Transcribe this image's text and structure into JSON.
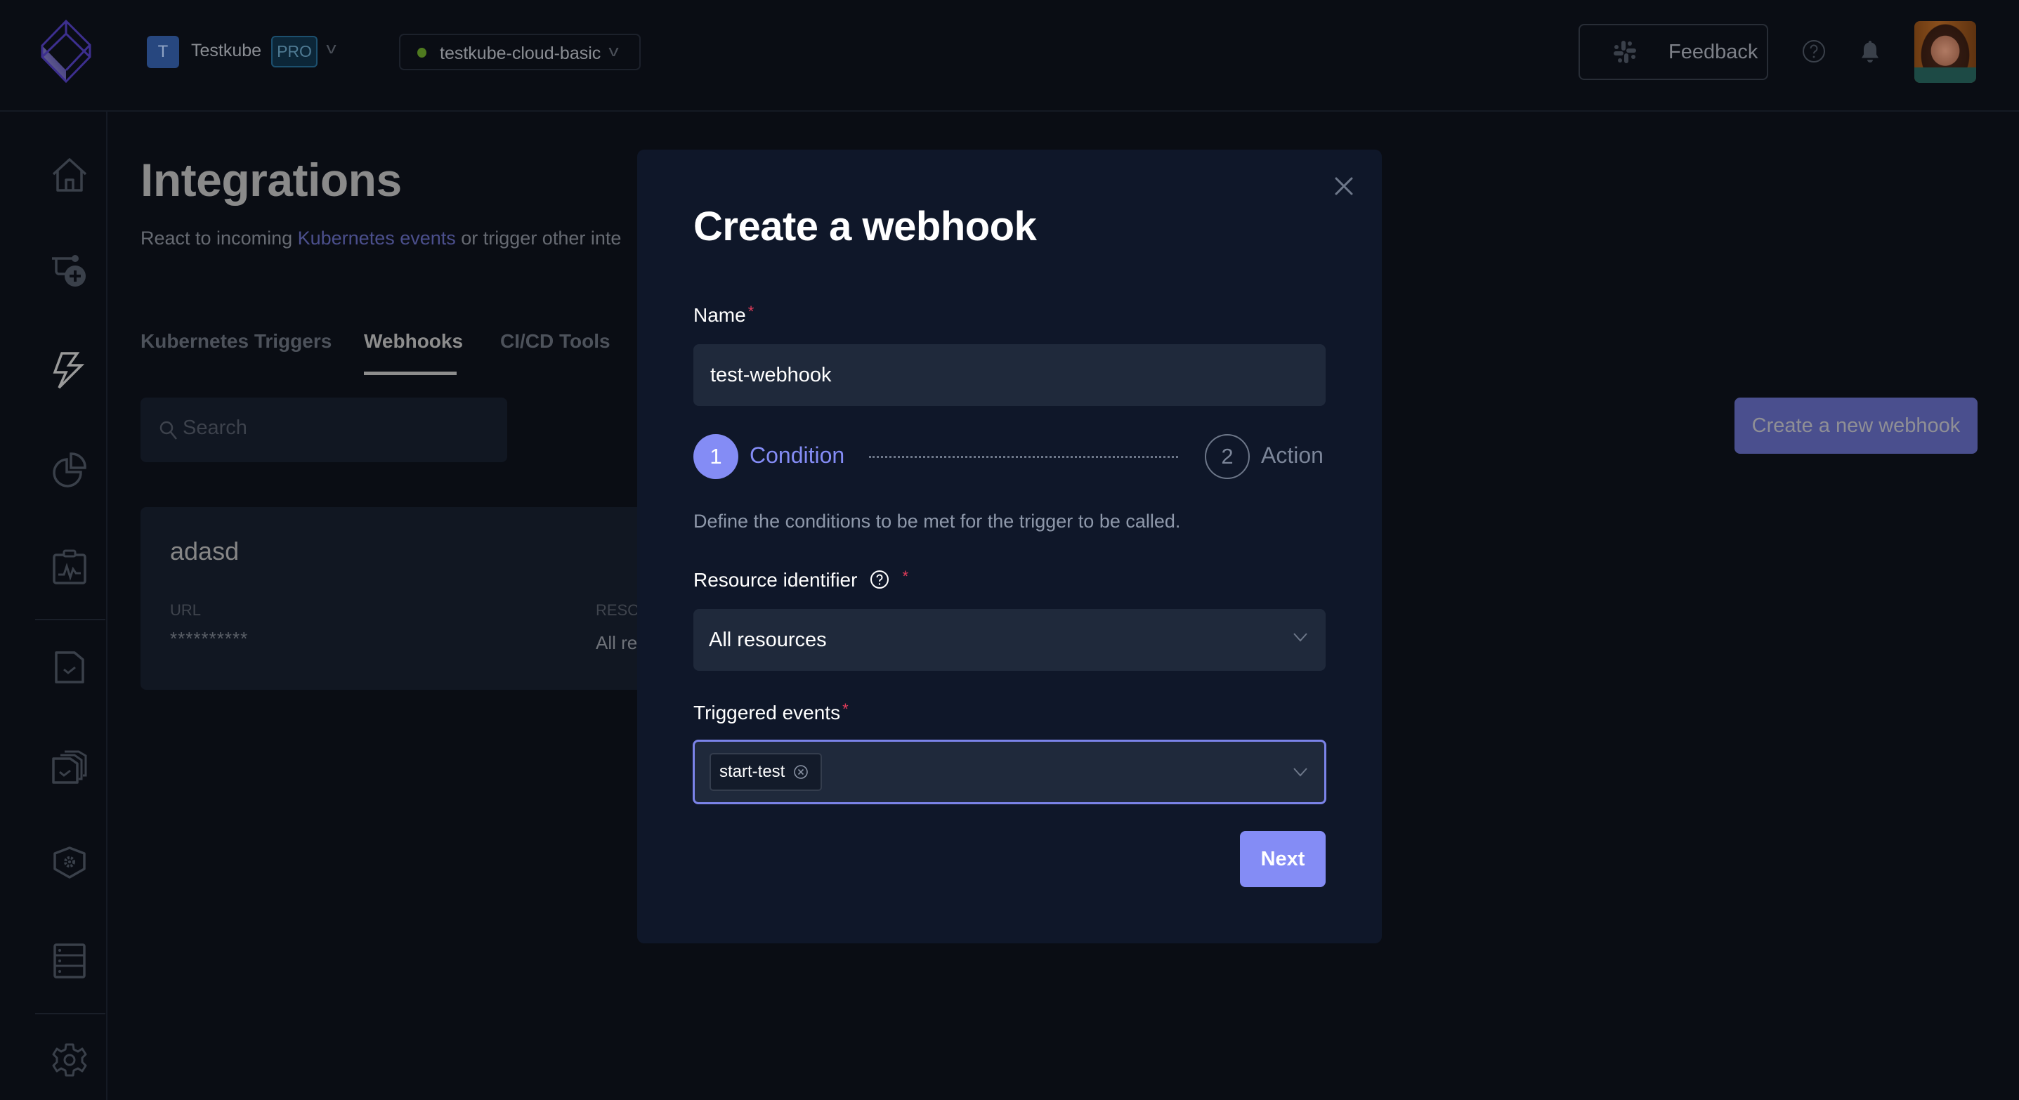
{
  "header": {
    "org": {
      "initial": "T",
      "name": "Testkube",
      "plan_badge": "PRO"
    },
    "environment": {
      "name": "testkube-cloud-basic",
      "status_color": "#4f7a1f"
    },
    "feedback_label": "Feedback"
  },
  "sidebar": {
    "items": [
      {
        "name": "home",
        "icon": "home-icon",
        "active": false
      },
      {
        "name": "triggers",
        "icon": "trigger-add-icon",
        "active": false
      },
      {
        "name": "integrations",
        "icon": "lightning-icon",
        "active": true
      },
      {
        "name": "analytics",
        "icon": "pie-chart-icon",
        "active": false
      },
      {
        "name": "status",
        "icon": "status-monitor-icon",
        "active": false
      },
      {
        "name": "tests",
        "icon": "test-file-icon",
        "active": false
      },
      {
        "name": "test-suites",
        "icon": "test-suites-icon",
        "active": false
      },
      {
        "name": "executors",
        "icon": "shield-gear-icon",
        "active": false
      },
      {
        "name": "sources",
        "icon": "server-icon",
        "active": false
      },
      {
        "name": "settings",
        "icon": "settings-gear-icon",
        "active": false
      }
    ]
  },
  "page": {
    "title": "Integrations",
    "subtitle_prefix": "React to incoming ",
    "subtitle_link": "Kubernetes events",
    "subtitle_suffix": " or trigger other inte",
    "tabs": [
      {
        "label": "Kubernetes Triggers",
        "active": false
      },
      {
        "label": "Webhooks",
        "active": true
      },
      {
        "label": "CI/CD Tools",
        "active": false
      }
    ],
    "search_placeholder": "Search",
    "create_button": "Create a new webhook",
    "webhooks": [
      {
        "name": "adasd",
        "url_label": "URL",
        "url_value": "**********",
        "resource_label": "RESO",
        "resource_value": "All res"
      }
    ]
  },
  "modal": {
    "title": "Create a webhook",
    "name_label": "Name",
    "name_value": "test-webhook",
    "required_mark": "*",
    "steps": [
      {
        "number": "1",
        "label": "Condition",
        "active": true
      },
      {
        "number": "2",
        "label": "Action",
        "active": false
      }
    ],
    "description": "Define the conditions to be met for the trigger to be called.",
    "resource_label": "Resource identifier",
    "resource_value": "All resources",
    "events_label": "Triggered events",
    "events_selected": [
      "start-test"
    ],
    "next_button": "Next",
    "accent_color": "#848cf5"
  }
}
